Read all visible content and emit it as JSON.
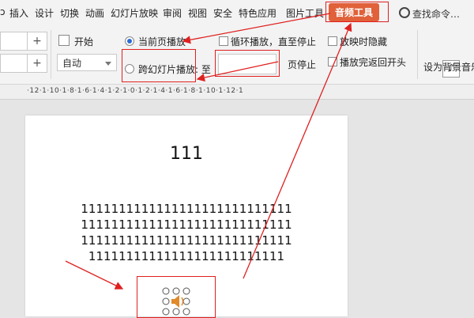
{
  "menubar": {
    "items": [
      "ↄ",
      "插入",
      "设计",
      "切换",
      "动画",
      "幻灯片放映",
      "审阅",
      "视图",
      "安全",
      "特色应用",
      "图片工具"
    ],
    "active_tab": "音频工具",
    "search_label": "查找命令…"
  },
  "ribbon": {
    "start_label": "开始",
    "start_value": "自动",
    "current_page_label": "当前页播放",
    "cross_slide_label": "跨幻灯片播放: 至",
    "stop_label": "页停止",
    "loop_label": "循环播放，直至停止",
    "hide_label": "放映时隐藏",
    "rewind_label": "播放完返回开头",
    "bg_music_label": "设为背景音乐",
    "plus1": "+",
    "plus2": "+"
  },
  "ruler": {
    "marks": "·12·1·10·1·8·1·6·1·4·1·2·1·0·1·2·1·4·1·6·1·8·1·10·1·12·1"
  },
  "slide": {
    "title": "111",
    "lines": [
      "1111111111111111111111111111",
      "1111111111111111111111111111",
      "1111111111111111111111111111",
      "11111111111111111111111111"
    ]
  },
  "colors": {
    "accent": "#e0613a",
    "annotation": "#e02020",
    "radio_selected": "#2a6ad6"
  },
  "icons": [
    "search-icon",
    "music-note-icon",
    "speaker-icon",
    "start-icon"
  ]
}
